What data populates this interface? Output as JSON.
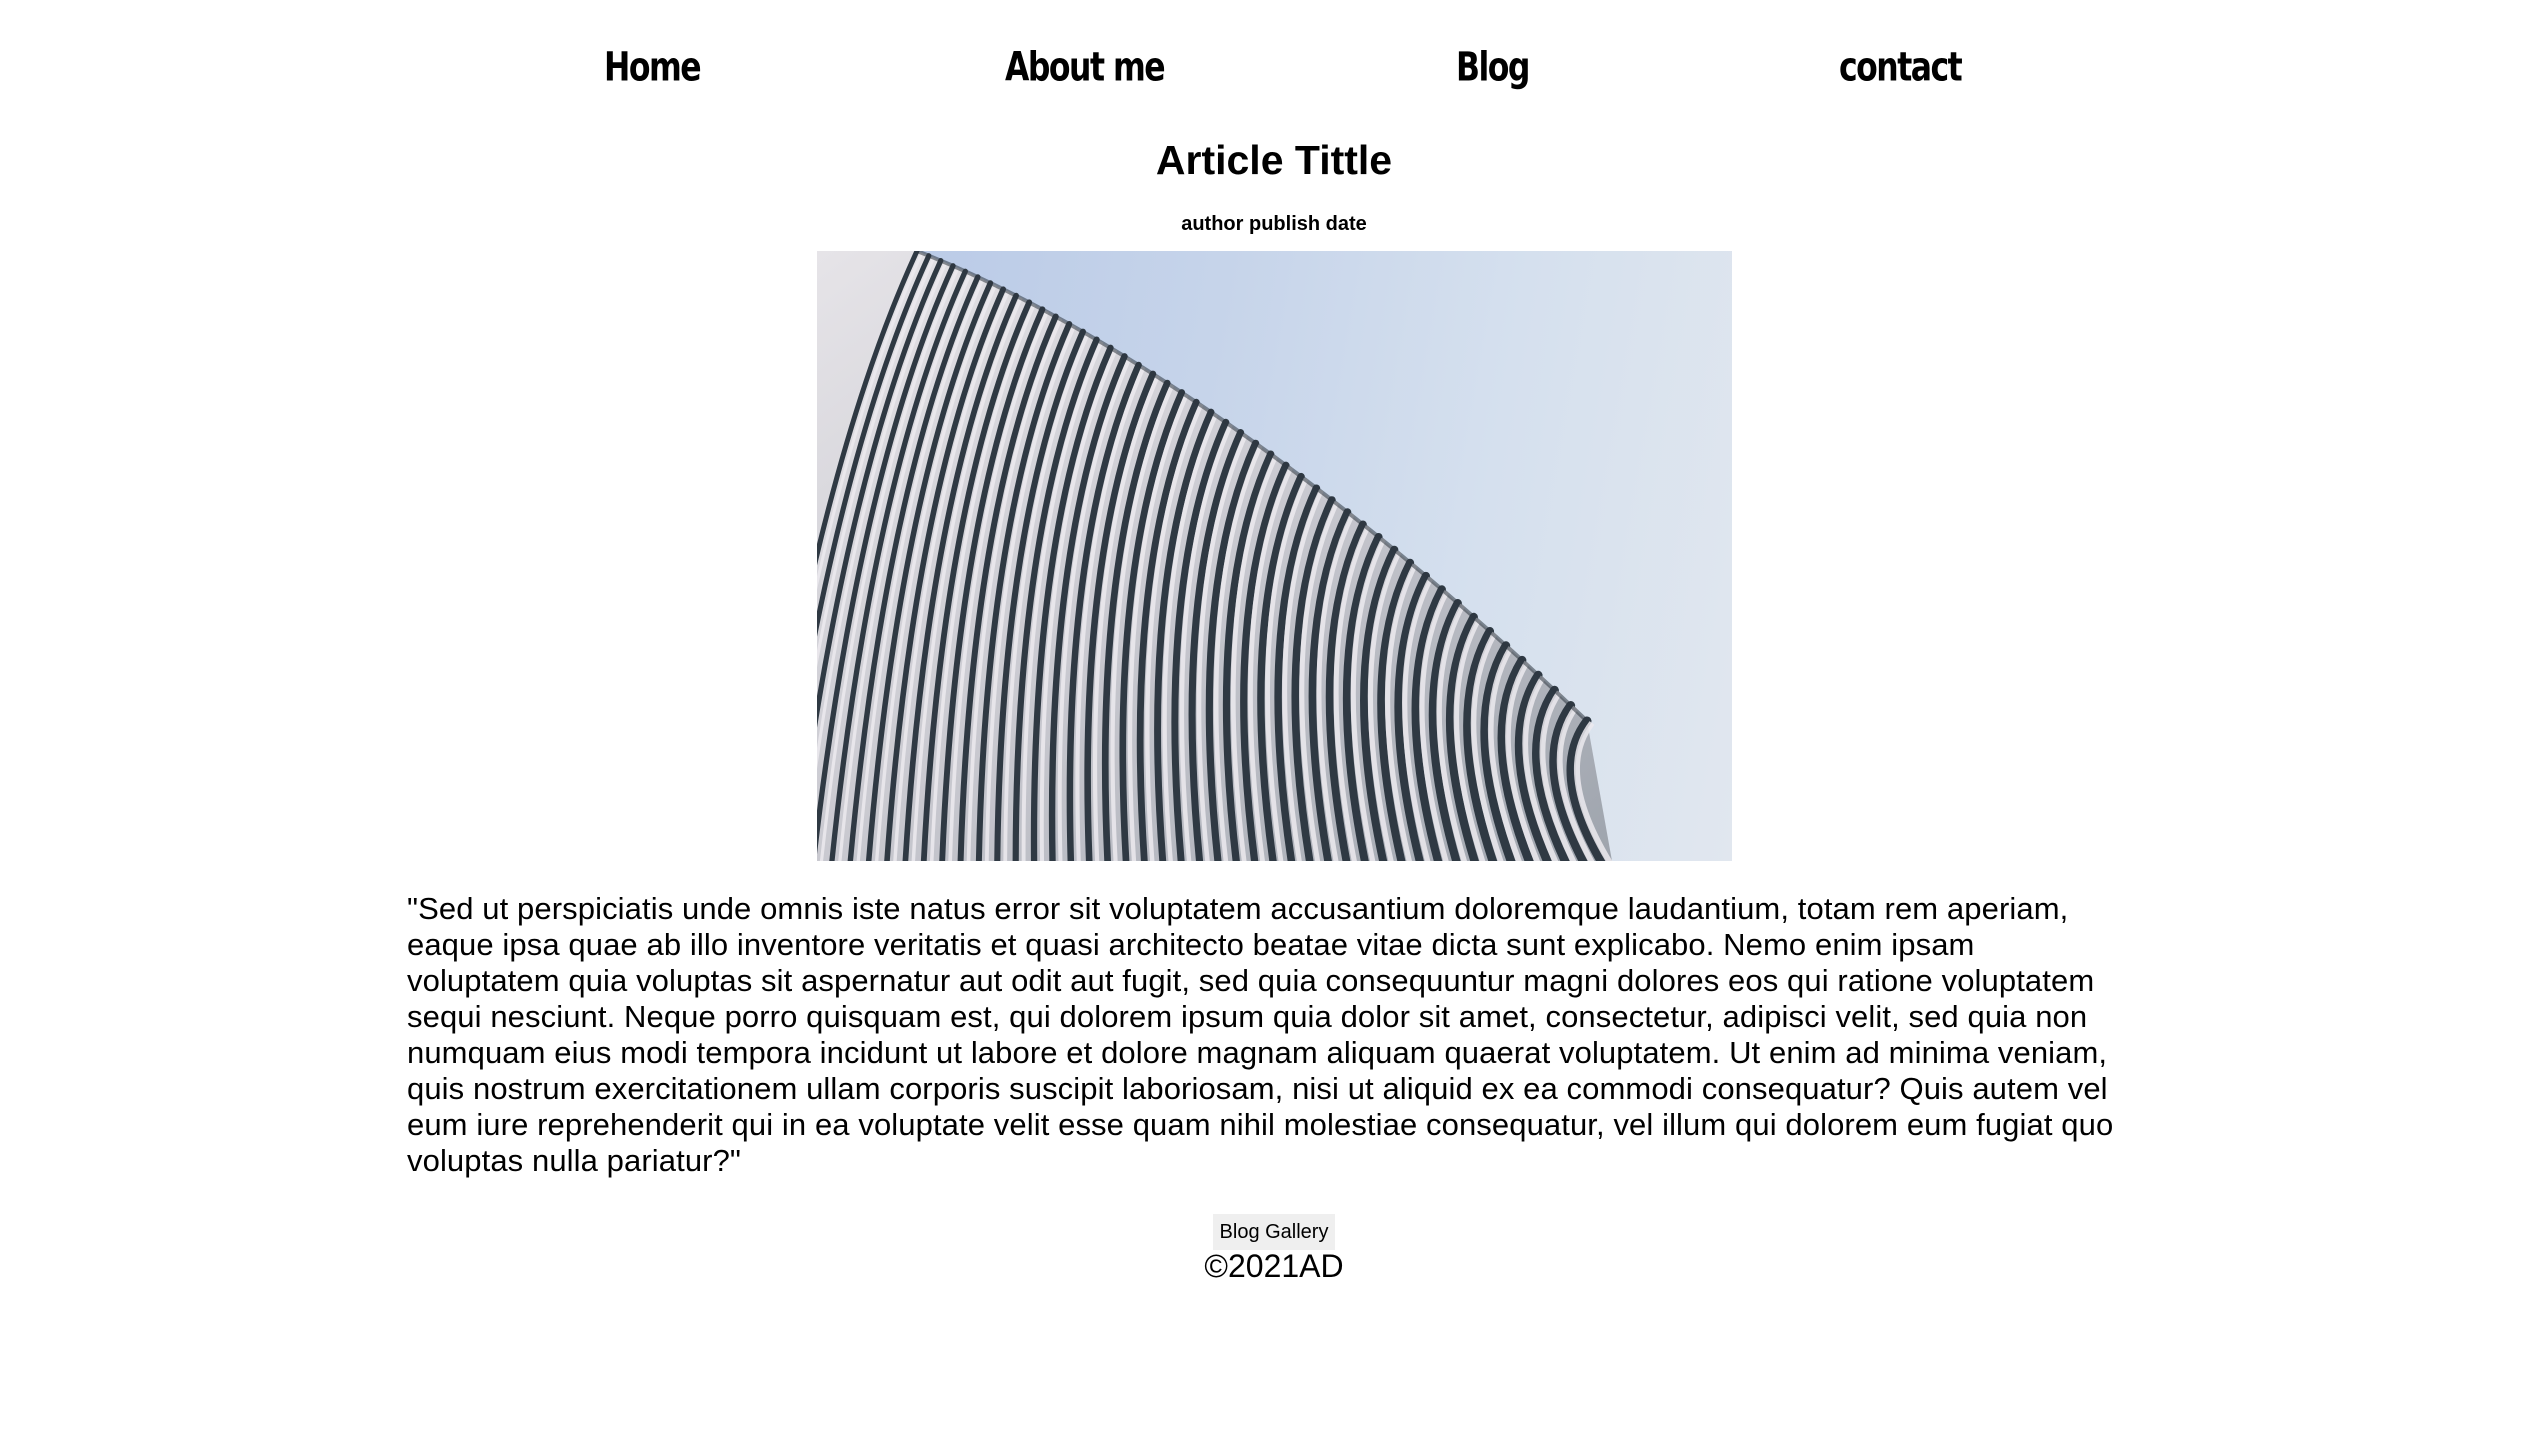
{
  "nav": {
    "items": [
      {
        "label": "Home"
      },
      {
        "label": "About me"
      },
      {
        "label": "Blog"
      },
      {
        "label": "contact"
      }
    ]
  },
  "article": {
    "title": "Article Tittle",
    "byline": "author publish date",
    "image_subject": "curved metal building facade against blue sky",
    "body": "\"Sed ut perspiciatis unde omnis iste natus error sit voluptatem accusantium doloremque laudantium, totam rem aperiam, eaque ipsa quae ab illo inventore veritatis et quasi architecto beatae vitae dicta sunt explicabo. Nemo enim ipsam voluptatem quia voluptas sit aspernatur aut odit aut fugit, sed quia consequuntur magni dolores eos qui ratione voluptatem sequi nesciunt. Neque porro quisquam est, qui dolorem ipsum quia dolor sit amet, consectetur, adipisci velit, sed quia non numquam eius modi tempora incidunt ut labore et dolore magnam aliquam quaerat voluptatem. Ut enim ad minima veniam, quis nostrum exercitationem ullam corporis suscipit laboriosam, nisi ut aliquid ex ea commodi consequatur? Quis autem vel eum iure reprehenderit qui in ea voluptate velit esse quam nihil molestiae consequatur, vel illum qui dolorem eum fugiat quo voluptas nulla pariatur?\""
  },
  "gallery_button": {
    "label": "Blog Gallery"
  },
  "footer": {
    "copyright": "©2021AD"
  },
  "colors": {
    "background": "#ffffff",
    "text": "#000000",
    "button_bg": "#efefef",
    "sky_light": "#e1e7ef",
    "sky_blue": "#b7c8e6"
  }
}
